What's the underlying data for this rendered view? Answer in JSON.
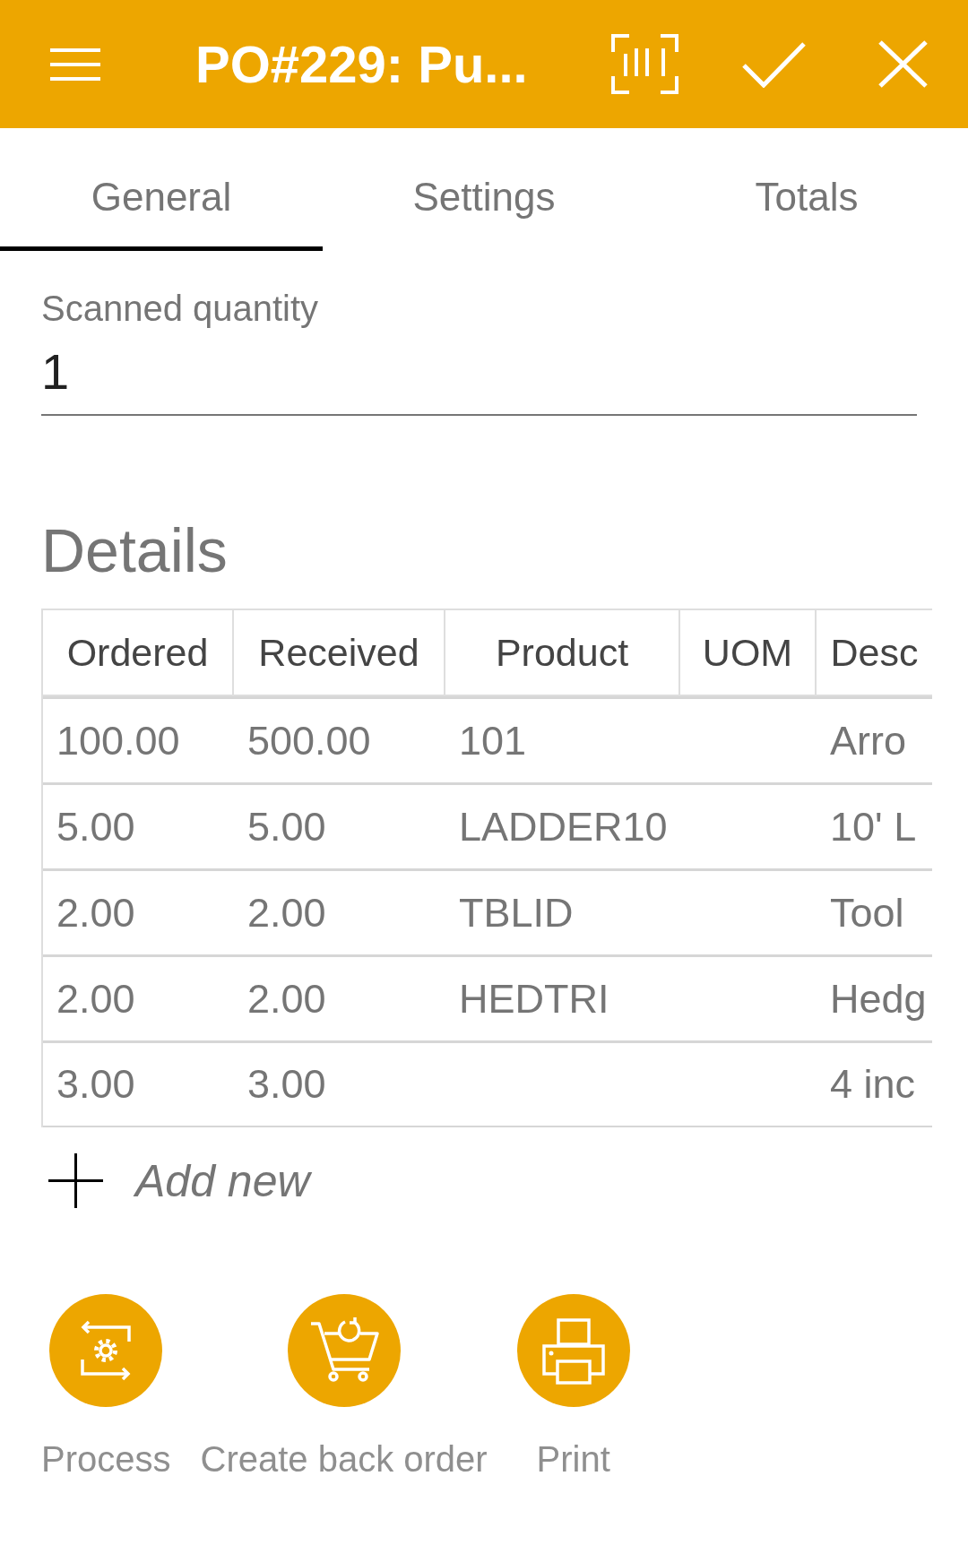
{
  "app_bar": {
    "title": "PO#229: Pu..."
  },
  "tabs": [
    {
      "label": "General",
      "selected": true
    },
    {
      "label": "Settings",
      "selected": false
    },
    {
      "label": "Totals",
      "selected": false
    }
  ],
  "scanned_quantity": {
    "label": "Scanned quantity",
    "value": "1"
  },
  "details": {
    "title": "Details",
    "columns": [
      "Ordered",
      "Received",
      "Product",
      "UOM",
      "Desc"
    ],
    "rows": [
      {
        "ordered": "100.00",
        "received": "500.00",
        "product": "101",
        "desc": "Arro"
      },
      {
        "ordered": "5.00",
        "received": "5.00",
        "product": "LADDER10",
        "desc": "10' L"
      },
      {
        "ordered": "2.00",
        "received": "2.00",
        "product": "TBLID",
        "desc": "Tool"
      },
      {
        "ordered": "2.00",
        "received": "2.00",
        "product": "HEDTRI",
        "desc": "Hedg"
      },
      {
        "ordered": "3.00",
        "received": "3.00",
        "desc": "4 inc"
      }
    ]
  },
  "add_new": {
    "label": "Add new"
  },
  "actions": [
    {
      "kind": "process",
      "label": "Process"
    },
    {
      "kind": "back_order",
      "label": "Create back order"
    },
    {
      "kind": "print",
      "label": "Print"
    }
  ]
}
